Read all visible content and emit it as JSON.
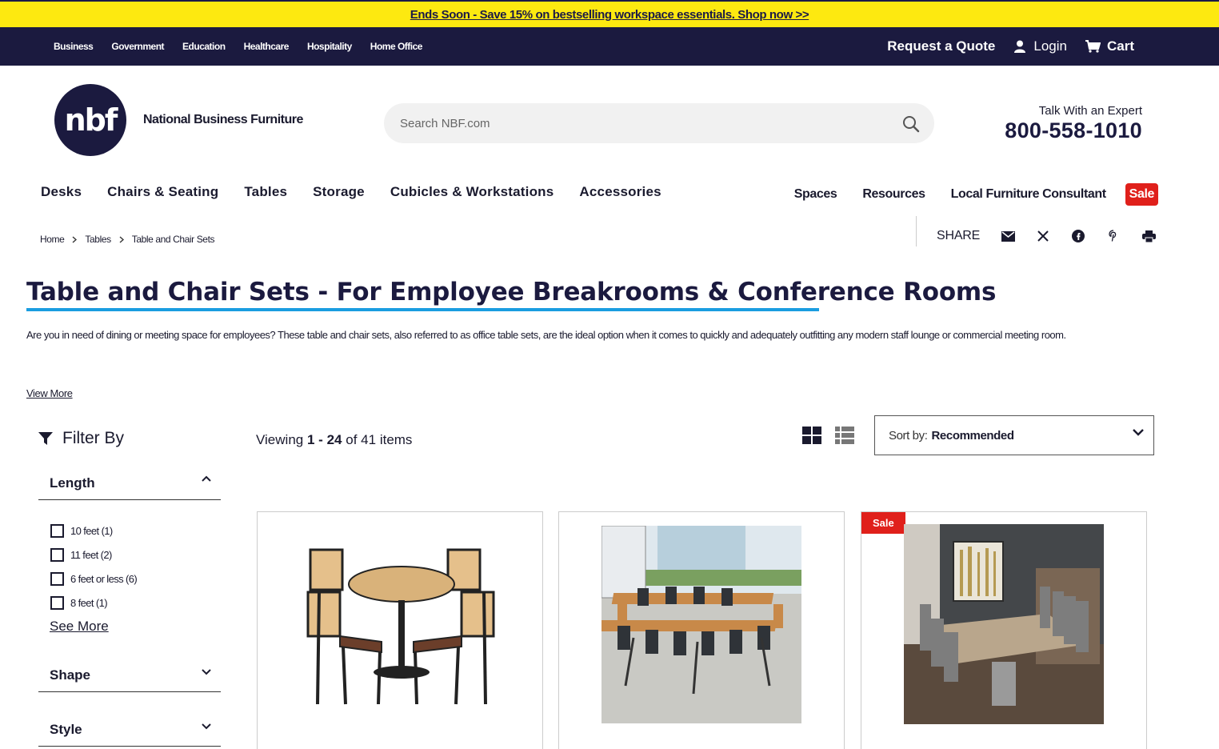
{
  "promo": {
    "text": "Ends Soon - Save 15% on bestselling workspace essentials. Shop now >>"
  },
  "topbar": {
    "segments": [
      "Business",
      "Government",
      "Education",
      "Healthcare",
      "Hospitality",
      "Home Office"
    ],
    "quote": "Request a Quote",
    "login": "Login",
    "cart": "Cart"
  },
  "brand": {
    "logo_text": "nbf",
    "name": "National Business Furniture"
  },
  "search": {
    "placeholder": "Search NBF.com"
  },
  "expert": {
    "label": "Talk With an Expert",
    "phone": "800-558-1010"
  },
  "mainnav": [
    "Desks",
    "Chairs & Seating",
    "Tables",
    "Storage",
    "Cubicles & Workstations",
    "Accessories"
  ],
  "subnav": [
    "Spaces",
    "Resources",
    "Local Furniture Consultant"
  ],
  "sale_label": "Sale",
  "breadcrumb": [
    "Home",
    "Tables",
    "Table and Chair Sets"
  ],
  "share": {
    "label": "SHARE",
    "icons": [
      "email-icon",
      "x-icon",
      "facebook-icon",
      "pinterest-icon",
      "print-icon"
    ]
  },
  "page": {
    "title": "Table and Chair Sets - For Employee Breakrooms & Conference Rooms",
    "description": "Are you in need of dining or meeting space for employees? These table and chair sets, also referred to as office table sets, are the ideal option when it comes to quickly and adequately outfitting any modern staff lounge or commercial meeting room.",
    "view_more": "View More"
  },
  "filters": {
    "heading": "Filter By",
    "groups": [
      {
        "title": "Length",
        "expanded": true,
        "options": [
          "10 feet (1)",
          "11 feet (2)",
          "6 feet or less (6)",
          "8 feet (1)"
        ],
        "see_more": "See More"
      },
      {
        "title": "Shape",
        "expanded": false
      },
      {
        "title": "Style",
        "expanded": false
      }
    ]
  },
  "results": {
    "viewing_prefix": "Viewing",
    "range_start": "1",
    "range_sep": "-",
    "range_end": "24",
    "of": "of",
    "total": "41",
    "items": "items"
  },
  "sort": {
    "label": "Sort by:",
    "value": "Recommended"
  },
  "products": [
    {
      "image": "cafe-table-set-image",
      "sale": false
    },
    {
      "image": "training-room-tables-image",
      "sale": false
    },
    {
      "image": "conference-room-set-image",
      "sale": true,
      "badge": "Sale"
    }
  ],
  "colors": {
    "navy": "#1b1a3f",
    "promo_yellow": "#fde910",
    "sale_red": "#e0201b",
    "accent_blue": "#1a9de0"
  }
}
